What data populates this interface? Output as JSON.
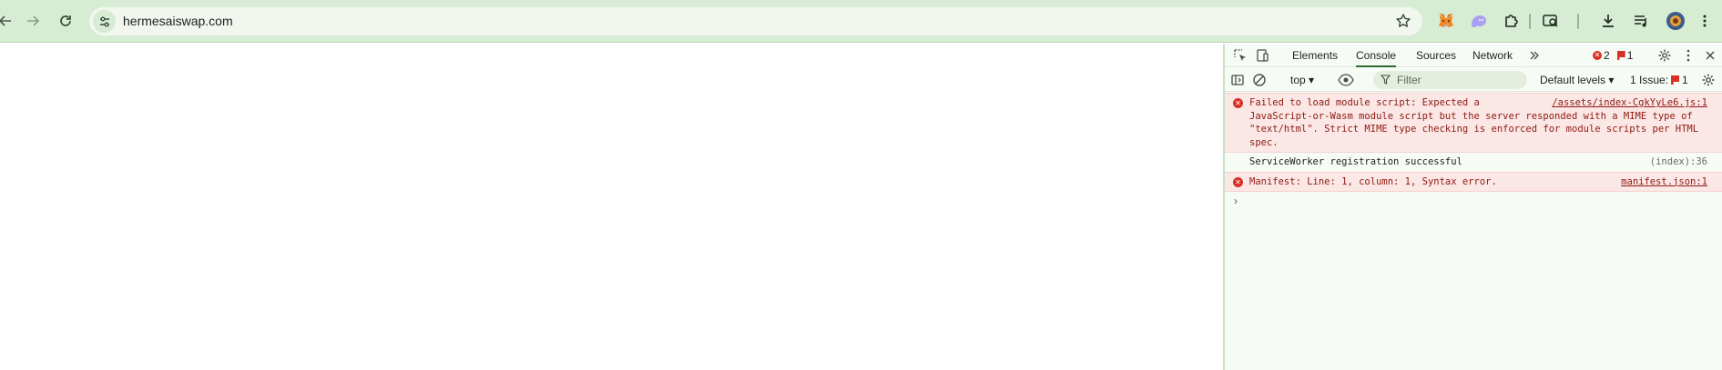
{
  "browser": {
    "url": "hermesaiswap.com"
  },
  "devtools": {
    "tabs": [
      "Elements",
      "Console",
      "Sources",
      "Network"
    ],
    "error_count": "2",
    "warning_count": "1",
    "context": "top",
    "filter_placeholder": "Filter",
    "levels": "Default levels",
    "issues_label": "1 Issue:",
    "issues_count": "1"
  },
  "console": {
    "messages": [
      {
        "type": "error",
        "text": "Failed to load module script: Expected a JavaScript-or-Wasm module script but the server responded with a MIME type of \"text/html\". Strict MIME type checking is enforced for module scripts per HTML spec.",
        "source": "/assets/index-CgkYyLe6.js:1"
      },
      {
        "type": "log",
        "text": "ServiceWorker registration successful",
        "source": "(index):36"
      },
      {
        "type": "error",
        "text": "Manifest: Line: 1, column: 1, Syntax error.",
        "source": "manifest.json:1"
      }
    ],
    "prompt_symbol": "›"
  }
}
